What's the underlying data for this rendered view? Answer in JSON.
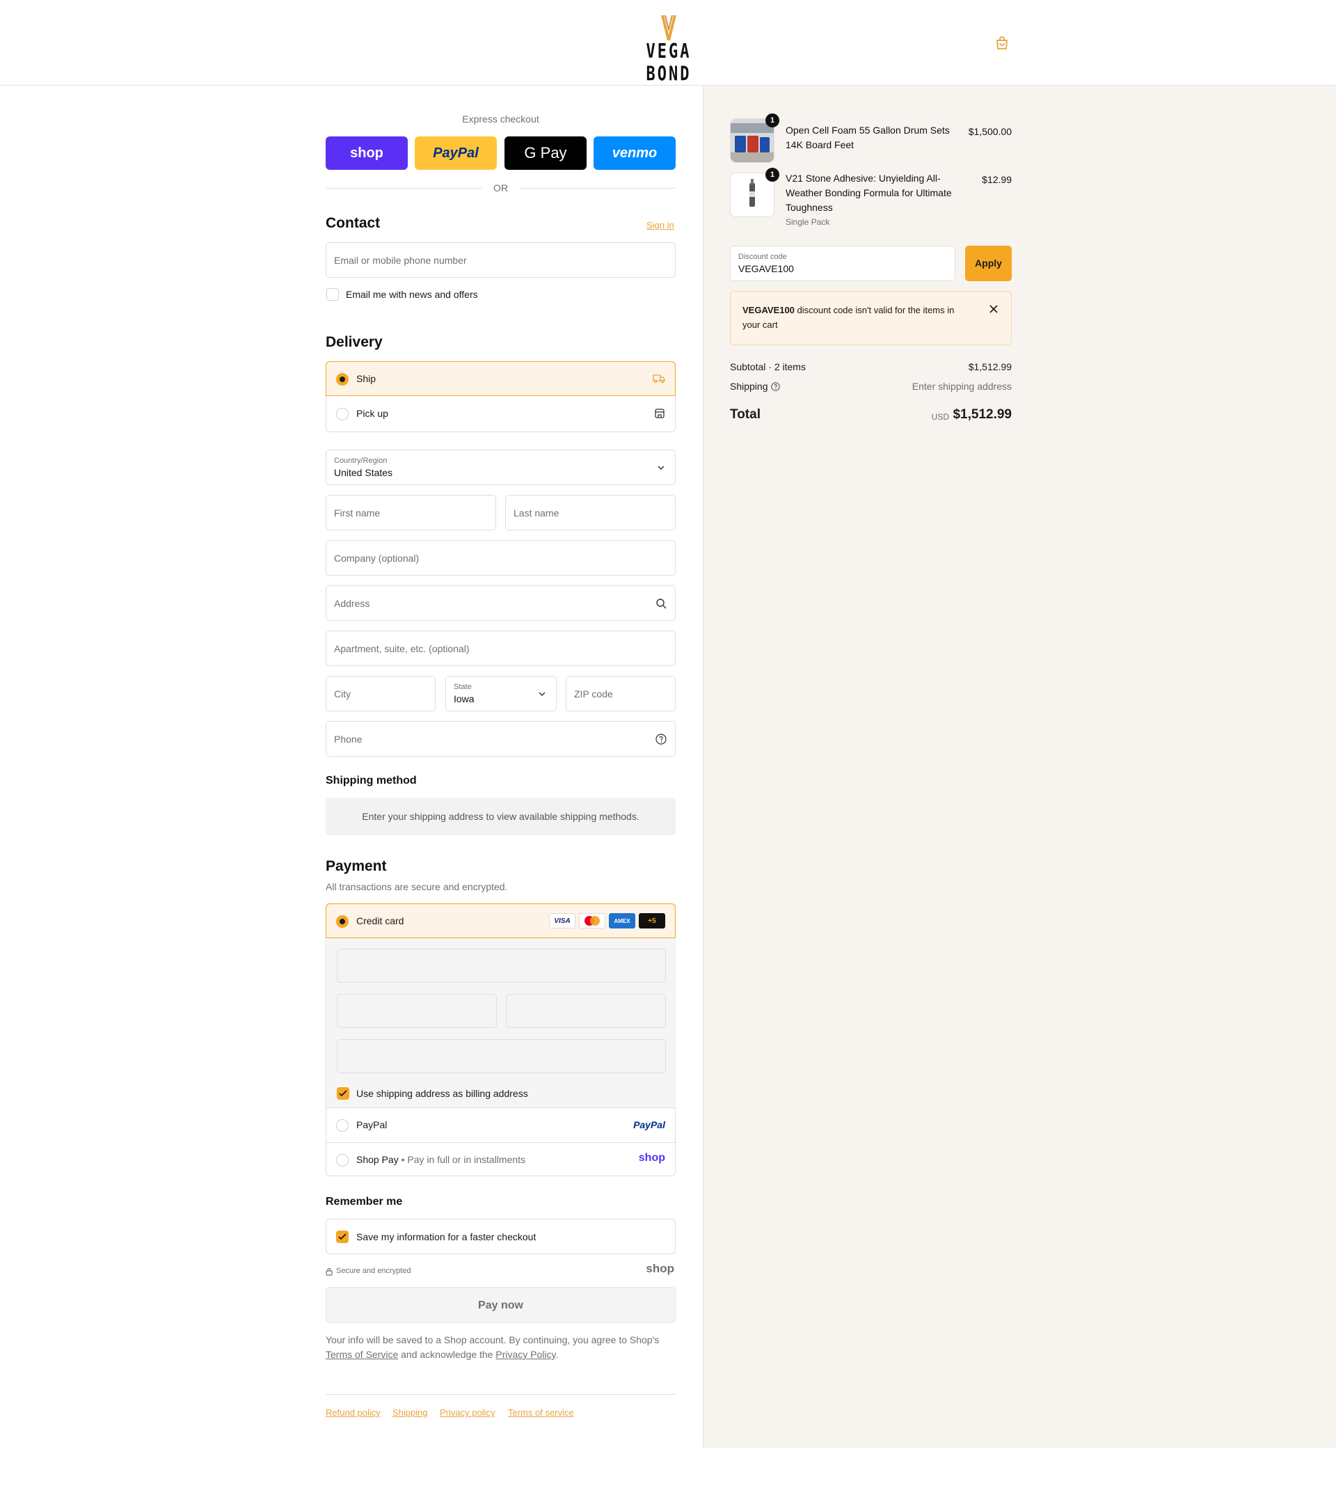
{
  "header": {
    "logo_text": "VEGA BOND",
    "cart_icon": "shopping-bag-icon"
  },
  "express": {
    "title": "Express checkout",
    "buttons": [
      {
        "label": "shop",
        "color": "#5a31f4",
        "text_color": "#ffffff"
      },
      {
        "label": "PayPal",
        "color": "#ffc439",
        "text_color": "#003087"
      },
      {
        "label": "G Pay",
        "color": "#000000",
        "text_color": "#ffffff"
      },
      {
        "label": "venmo",
        "color": "#008cff",
        "text_color": "#ffffff"
      }
    ],
    "or": "OR"
  },
  "contact": {
    "title": "Contact",
    "sign_in": "Sign in",
    "email_placeholder": "Email or mobile phone number",
    "news_label": "Email me with news and offers"
  },
  "delivery": {
    "title": "Delivery",
    "options": [
      {
        "label": "Ship",
        "selected": true,
        "icon": "truck-icon"
      },
      {
        "label": "Pick up",
        "selected": false,
        "icon": "store-icon"
      }
    ],
    "country_label": "Country/Region",
    "country_value": "United States",
    "first_name": "First name",
    "last_name": "Last name",
    "company": "Company (optional)",
    "address": "Address",
    "apartment": "Apartment, suite, etc. (optional)",
    "city": "City",
    "state_label": "State",
    "state_value": "Iowa",
    "zip": "ZIP code",
    "phone": "Phone"
  },
  "shipping_method": {
    "title": "Shipping method",
    "notice": "Enter your shipping address to view available shipping methods."
  },
  "payment": {
    "title": "Payment",
    "subtitle": "All transactions are secure and encrypted.",
    "credit_card": "Credit card",
    "card_badges": [
      "VISA",
      "MC",
      "AMEX",
      "+5"
    ],
    "billing_label": "Use shipping address as billing address",
    "paypal": "PayPal",
    "paypal_logo": "PayPal",
    "shop_pay": "Shop Pay",
    "shop_pay_note": "Pay in full or in installments",
    "shop_logo": "shop"
  },
  "remember": {
    "title": "Remember me",
    "save_label": "Save my information for a faster checkout",
    "secure": "Secure and encrypted",
    "shop_logo": "shop"
  },
  "pay_now": "Pay now",
  "legal": {
    "text1": "Your info will be saved to a Shop account. By continuing, you agree to Shop's",
    "terms": "Terms of Service",
    "text2": "and acknowledge the",
    "privacy": "Privacy Policy",
    "text3": "."
  },
  "footer_links": [
    "Refund policy",
    "Shipping",
    "Privacy policy",
    "Terms of service"
  ],
  "cart": {
    "items": [
      {
        "name": "Open Cell Foam 55 Gallon Drum Sets 14K Board Feet",
        "price": "$1,500.00",
        "qty": "1",
        "variant": ""
      },
      {
        "name": "V21 Stone Adhesive: Unyielding All-Weather Bonding Formula for Ultimate Toughness",
        "price": "$12.99",
        "qty": "1",
        "variant": "Single Pack"
      }
    ],
    "discount_label": "Discount code",
    "discount_value": "VEGAVE100",
    "apply": "Apply",
    "warning_code": "VEGAVE100",
    "warning_text": "discount code isn't valid for the items in your cart",
    "subtotal_label": "Subtotal · 2 items",
    "subtotal_value": "$1,512.99",
    "shipping_label": "Shipping",
    "shipping_value": "Enter shipping address",
    "total_label": "Total",
    "currency": "USD",
    "total_value": "$1,512.99"
  },
  "colors": {
    "accent": "#f5a623",
    "link": "#e8a33d",
    "summary_bg": "#f7f4f0"
  }
}
